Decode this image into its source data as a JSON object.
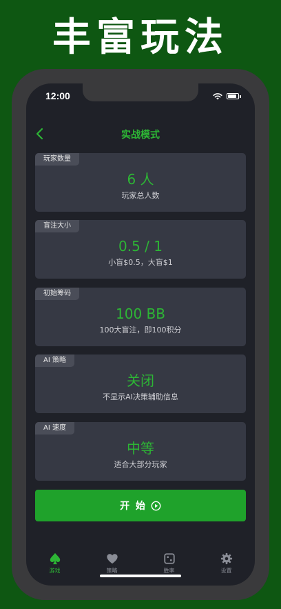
{
  "headline": "丰富玩法",
  "status": {
    "time": "12:00"
  },
  "nav": {
    "title": "实战模式"
  },
  "cards": [
    {
      "tag": "玩家数量",
      "value": "6 人",
      "desc": "玩家总人数"
    },
    {
      "tag": "盲注大小",
      "value": "0.5 / 1",
      "desc": "小盲$0.5，大盲$1"
    },
    {
      "tag": "初始筹码",
      "value": "100 BB",
      "desc": "100大盲注，即100积分"
    },
    {
      "tag": "AI 策略",
      "value": "关闭",
      "desc": "不显示AI决策辅助信息"
    },
    {
      "tag": "AI 速度",
      "value": "中等",
      "desc": "适合大部分玩家"
    }
  ],
  "start_button": {
    "label": "开 始"
  },
  "tabs": [
    {
      "label": "游戏",
      "icon": "spade-icon",
      "active": true
    },
    {
      "label": "策略",
      "icon": "heart-icon",
      "active": false
    },
    {
      "label": "胜率",
      "icon": "dice-icon",
      "active": false
    },
    {
      "label": "设置",
      "icon": "gear-icon",
      "active": false
    }
  ],
  "colors": {
    "background": "#0e5712",
    "accent": "#2db535",
    "button": "#1fa22b",
    "card": "#363944",
    "screen": "#1f2128"
  }
}
